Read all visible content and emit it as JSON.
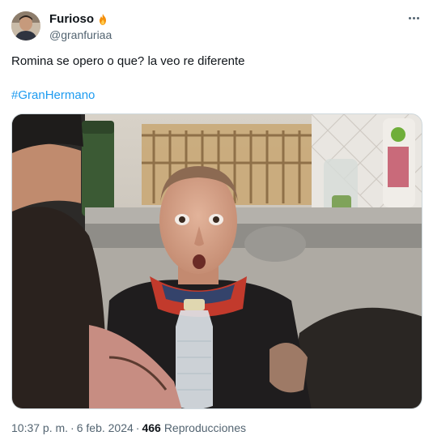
{
  "author": {
    "display_name": "Furioso",
    "handle": "@granfuriaa",
    "badge_icon": "fire-icon"
  },
  "tweet": {
    "text": "Romina se opero o que? la veo re diferente",
    "hashtag": "#GranHermano"
  },
  "meta": {
    "time": "10:37 p. m.",
    "separator": "·",
    "date": "6 feb. 2024",
    "views_count": "466",
    "views_label": "Reproducciones"
  },
  "colors": {
    "text": "#0f1419",
    "secondary": "#536471",
    "link": "#1d9bf0",
    "border": "#cfd9de"
  }
}
